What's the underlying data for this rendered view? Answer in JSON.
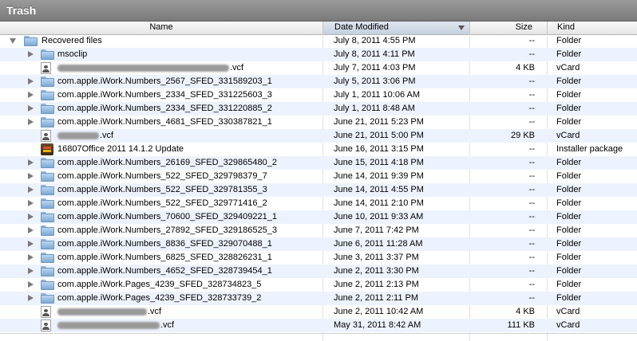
{
  "window": {
    "title": "Trash"
  },
  "columns": {
    "name": "Name",
    "date": "Date Modified",
    "size": "Size",
    "kind": "Kind"
  },
  "sort_column": "date",
  "rows": [
    {
      "name": "Recovered files",
      "date": "July 8, 2011 4:55 PM",
      "size": "--",
      "kind": "Folder",
      "icon": "folder-icon",
      "expand": "open",
      "depth": 0
    },
    {
      "name": "msoclip",
      "date": "July 8, 2011 4:11 PM",
      "size": "--",
      "kind": "Folder",
      "icon": "folder-icon",
      "expand": "closed",
      "depth": 1
    },
    {
      "name": ".vcf",
      "date": "July 7, 2011 4:03 PM",
      "size": "4 KB",
      "kind": "vCard",
      "icon": "vcard-icon",
      "expand": "none",
      "depth": 1,
      "redacted": true
    },
    {
      "name": "com.apple.iWork.Numbers_2567_SFED_331589203_1",
      "date": "July 5, 2011 3:06 PM",
      "size": "--",
      "kind": "Folder",
      "icon": "folder-icon",
      "expand": "closed",
      "depth": 1
    },
    {
      "name": "com.apple.iWork.Numbers_2334_SFED_331225603_3",
      "date": "July 1, 2011 10:06 AM",
      "size": "--",
      "kind": "Folder",
      "icon": "folder-icon",
      "expand": "closed",
      "depth": 1
    },
    {
      "name": "com.apple.iWork.Numbers_2334_SFED_331220885_2",
      "date": "July 1, 2011 8:48 AM",
      "size": "--",
      "kind": "Folder",
      "icon": "folder-icon",
      "expand": "closed",
      "depth": 1
    },
    {
      "name": "com.apple.iWork.Numbers_4681_SFED_330387821_1",
      "date": "June 21, 2011 5:23 PM",
      "size": "--",
      "kind": "Folder",
      "icon": "folder-icon",
      "expand": "closed",
      "depth": 1
    },
    {
      "name": ".vcf",
      "date": "June 21, 2011 5:00 PM",
      "size": "29 KB",
      "kind": "vCard",
      "icon": "vcard-icon",
      "expand": "none",
      "depth": 1,
      "redacted": true
    },
    {
      "name": "16807Office 2011 14.1.2 Update",
      "date": "June 16, 2011 3:15 PM",
      "size": "--",
      "kind": "Installer package",
      "icon": "package-icon",
      "expand": "none",
      "depth": 1
    },
    {
      "name": "com.apple.iWork.Numbers_26169_SFED_329865480_2",
      "date": "June 15, 2011 4:18 PM",
      "size": "--",
      "kind": "Folder",
      "icon": "folder-icon",
      "expand": "closed",
      "depth": 1
    },
    {
      "name": "com.apple.iWork.Numbers_522_SFED_329798379_7",
      "date": "June 14, 2011 9:39 PM",
      "size": "--",
      "kind": "Folder",
      "icon": "folder-icon",
      "expand": "closed",
      "depth": 1
    },
    {
      "name": "com.apple.iWork.Numbers_522_SFED_329781355_3",
      "date": "June 14, 2011 4:55 PM",
      "size": "--",
      "kind": "Folder",
      "icon": "folder-icon",
      "expand": "closed",
      "depth": 1
    },
    {
      "name": "com.apple.iWork.Numbers_522_SFED_329771416_2",
      "date": "June 14, 2011 2:10 PM",
      "size": "--",
      "kind": "Folder",
      "icon": "folder-icon",
      "expand": "closed",
      "depth": 1
    },
    {
      "name": "com.apple.iWork.Numbers_70600_SFED_329409221_1",
      "date": "June 10, 2011 9:33 AM",
      "size": "--",
      "kind": "Folder",
      "icon": "folder-icon",
      "expand": "closed",
      "depth": 1
    },
    {
      "name": "com.apple.iWork.Numbers_27892_SFED_329186525_3",
      "date": "June 7, 2011 7:42 PM",
      "size": "--",
      "kind": "Folder",
      "icon": "folder-icon",
      "expand": "closed",
      "depth": 1
    },
    {
      "name": "com.apple.iWork.Numbers_8836_SFED_329070488_1",
      "date": "June 6, 2011 11:28 AM",
      "size": "--",
      "kind": "Folder",
      "icon": "folder-icon",
      "expand": "closed",
      "depth": 1
    },
    {
      "name": "com.apple.iWork.Numbers_6825_SFED_328826231_1",
      "date": "June 3, 2011 3:37 PM",
      "size": "--",
      "kind": "Folder",
      "icon": "folder-icon",
      "expand": "closed",
      "depth": 1
    },
    {
      "name": "com.apple.iWork.Numbers_4652_SFED_328739454_1",
      "date": "June 2, 2011 3:30 PM",
      "size": "--",
      "kind": "Folder",
      "icon": "folder-icon",
      "expand": "closed",
      "depth": 1
    },
    {
      "name": "com.apple.iWork.Pages_4239_SFED_328734823_5",
      "date": "June 2, 2011 2:13 PM",
      "size": "--",
      "kind": "Folder",
      "icon": "folder-icon",
      "expand": "closed",
      "depth": 1
    },
    {
      "name": "com.apple.iWork.Pages_4239_SFED_328733739_2",
      "date": "June 2, 2011 2:11 PM",
      "size": "--",
      "kind": "Folder",
      "icon": "folder-icon",
      "expand": "closed",
      "depth": 1
    },
    {
      "name": ".vcf",
      "date": "June 2, 2011 10:42 AM",
      "size": "4 KB",
      "kind": "vCard",
      "icon": "vcard-icon",
      "expand": "none",
      "depth": 1,
      "redacted": true
    },
    {
      "name": ".vcf",
      "date": "May 31, 2011 8:42 AM",
      "size": "111 KB",
      "kind": "vCard",
      "icon": "vcard-icon",
      "expand": "none",
      "depth": 1,
      "redacted": true
    }
  ]
}
